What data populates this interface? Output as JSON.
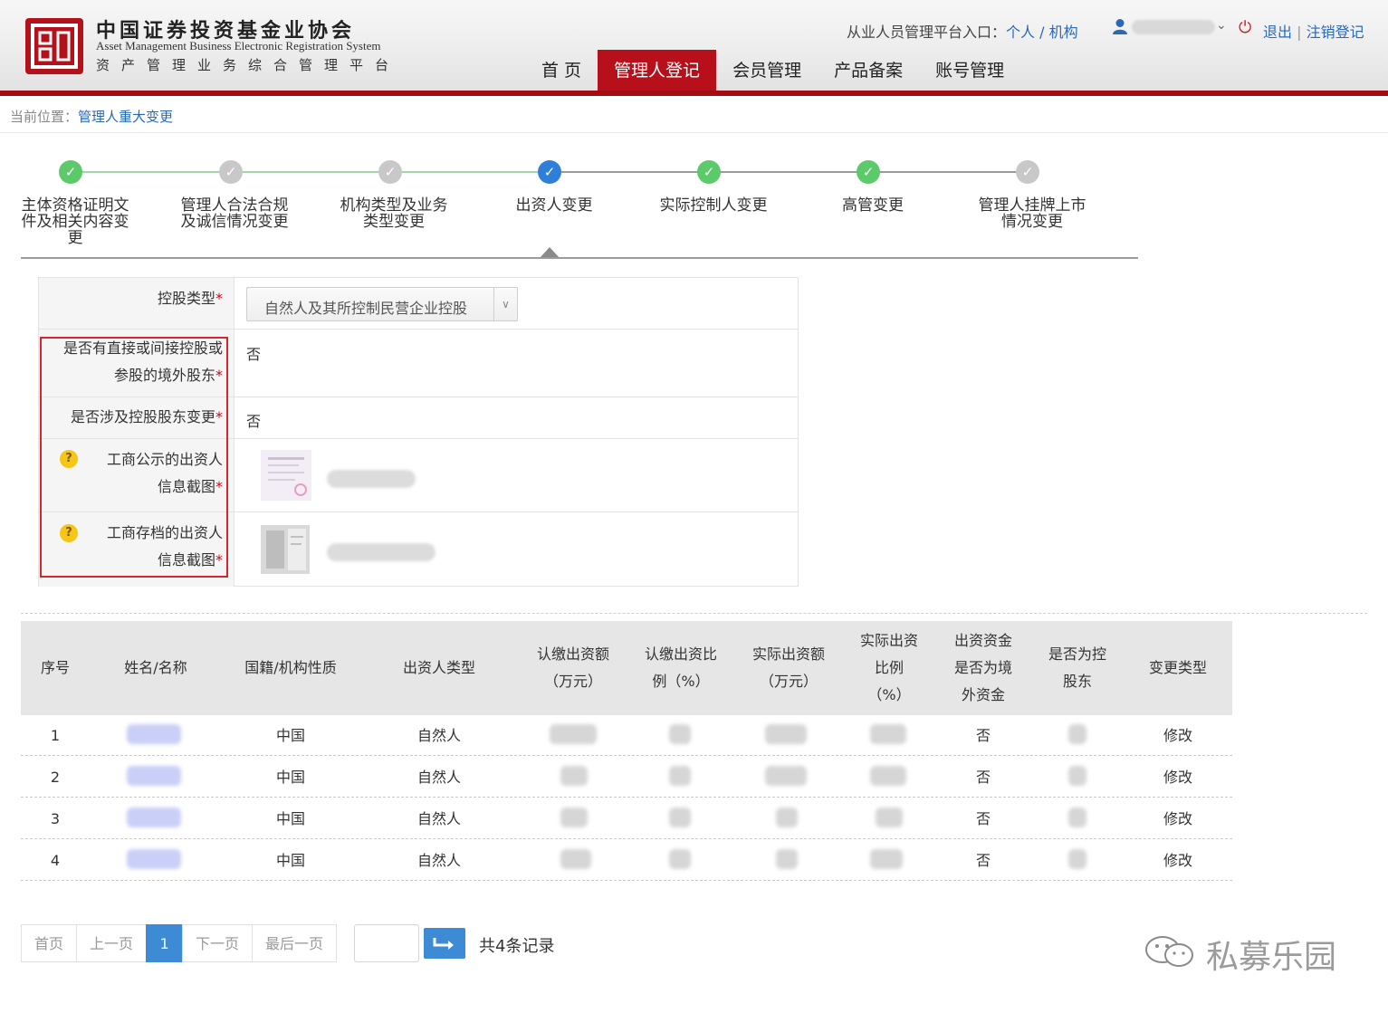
{
  "header": {
    "org_cn": "中国证券投资基金业协会",
    "org_en": "Asset Management Business Electronic Registration System",
    "org_sub": "资产管理业务综合管理平台",
    "platform_prefix": "从业人员管理平台入口：",
    "link_personal": "个人",
    "link_slash": " / ",
    "link_org": "机构",
    "logout": "退出",
    "separator": "|",
    "cancel_reg": "注销登记"
  },
  "nav": {
    "items": [
      {
        "label": "首 页",
        "active": false
      },
      {
        "label": "管理人登记",
        "active": true
      },
      {
        "label": "会员管理",
        "active": false
      },
      {
        "label": "产品备案",
        "active": false
      },
      {
        "label": "账号管理",
        "active": false
      }
    ]
  },
  "breadcrumb": {
    "prefix": "当前位置：",
    "current": "管理人重大变更"
  },
  "steps": [
    {
      "label": "主体资格证明文件及相关内容变更",
      "status": "done"
    },
    {
      "label": "管理人合法合规及诚信情况变更",
      "status": "pending"
    },
    {
      "label": "机构类型及业务类型变更",
      "status": "pending"
    },
    {
      "label": "出资人变更",
      "status": "current"
    },
    {
      "label": "实际控制人变更",
      "status": "done"
    },
    {
      "label": "高管变更",
      "status": "done"
    },
    {
      "label": "管理人挂牌上市情况变更",
      "status": "pending"
    }
  ],
  "form": {
    "holding_type_label": "控股类型",
    "holding_type_value": "自然人及其所控制民营企业控股",
    "offshore_label_1": "是否有直接或间接控股或",
    "offshore_label_2": "参股的境外股东",
    "offshore_value": "否",
    "controlling_change_label": "是否涉及控股股东变更",
    "controlling_change_value": "否",
    "public_screenshot_label_1": "工商公示的出资人",
    "public_screenshot_label_2": "信息截图",
    "archive_screenshot_label_1": "工商存档的出资人",
    "archive_screenshot_label_2": "信息截图",
    "required_mark": "*",
    "help_mark": "?"
  },
  "table": {
    "headers": [
      [
        "序号"
      ],
      [
        "姓名/名称"
      ],
      [
        "国籍/机构性质"
      ],
      [
        "出资人类型"
      ],
      [
        "认缴出资额",
        "（万元）"
      ],
      [
        "认缴出资比",
        "例（%）"
      ],
      [
        "实际出资额",
        "（万元）"
      ],
      [
        "实际出资",
        "比例",
        "（%）"
      ],
      [
        "出资资金",
        "是否为境",
        "外资金"
      ],
      [
        "是否为控",
        "股东"
      ],
      [
        "变更类型"
      ]
    ],
    "rows": [
      {
        "no": "1",
        "nationality": "中国",
        "type": "自然人",
        "offshore": "否",
        "change": "修改"
      },
      {
        "no": "2",
        "nationality": "中国",
        "type": "自然人",
        "offshore": "否",
        "change": "修改"
      },
      {
        "no": "3",
        "nationality": "中国",
        "type": "自然人",
        "offshore": "否",
        "change": "修改"
      },
      {
        "no": "4",
        "nationality": "中国",
        "type": "自然人",
        "offshore": "否",
        "change": "修改"
      }
    ]
  },
  "pager": {
    "first": "首页",
    "prev": "上一页",
    "current": "1",
    "next": "下一页",
    "last": "最后一页",
    "total": "共4条记录"
  },
  "watermark": "私募乐园",
  "colors": {
    "brand_red": "#b8101a",
    "link_blue": "#2a68b8",
    "step_done": "#5cc96b",
    "step_current": "#2f7fd8",
    "step_pending": "#c8c8c8"
  }
}
